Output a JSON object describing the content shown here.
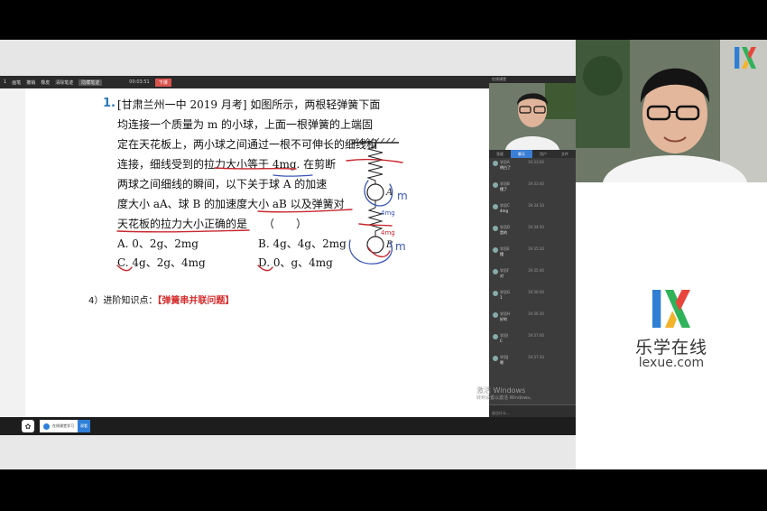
{
  "toolbar": {
    "items": [
      "1",
      "画笔",
      "撤销",
      "橡皮",
      "清除笔迹",
      "隐藏笔迹"
    ],
    "time": "00:03:51",
    "button": "下课"
  },
  "question": {
    "number": "1.",
    "lines": [
      "[甘肃兰州一中 2019 月考] 如图所示，两根轻弹簧下面",
      "均连接一个质量为 m 的小球，上面一根弹簧的上端固",
      "定在天花板上，两小球之间通过一根不可伸长的细线相",
      "连接，细线受到的拉力大小等于 4mg. 在剪断",
      "两球之间细线的瞬间，以下关于球 A 的加速",
      "度大小 aA、球 B 的加速度大小 aB 以及弹簧对",
      "天花板的拉力大小正确的是　　（　　）"
    ],
    "options": {
      "A": "A. 0、2g、2mg",
      "B": "B. 4g、4g、2mg",
      "C": "C. 4g、2g、4mg",
      "D": "D. 0、g、4mg"
    }
  },
  "advanced": {
    "prefix": "4）进阶知识点：",
    "highlight": "【弹簧串并联问题】"
  },
  "diagram": {
    "label_a": "A",
    "label_b": "B",
    "ink_m1": "m",
    "ink_m2": "m",
    "ink_4mg1": "4mg",
    "ink_4mg2": "4mg"
  },
  "panel": {
    "header": "在线课堂",
    "tabs": [
      "答疑",
      "聊天",
      "用户",
      "文件"
    ],
    "messages": [
      {
        "name": "学员A",
        "time": "19:33:00",
        "text": "明白了"
      },
      {
        "name": "学员B",
        "time": "19:33:40",
        "text": "懂了"
      },
      {
        "name": "学员C",
        "time": "19:34:10",
        "text": "4mg"
      },
      {
        "name": "学员D",
        "time": "19:34:50",
        "text": "是的"
      },
      {
        "name": "学员E",
        "time": "19:35:20",
        "text": "懂"
      },
      {
        "name": "学员F",
        "time": "19:35:40",
        "text": "对"
      },
      {
        "name": "学员G",
        "time": "19:36:00",
        "text": "1"
      },
      {
        "name": "学员H",
        "time": "19:36:30",
        "text": "好的"
      },
      {
        "name": "学员I",
        "time": "19:37:00",
        "text": "C"
      },
      {
        "name": "学员J",
        "time": "19:37:30",
        "text": "嗯"
      }
    ],
    "input_placeholder": "说点什么..."
  },
  "taskbar": {
    "task_label": "在线课堂学习",
    "task_button": "观看"
  },
  "watermark": {
    "line1": "激活 Windows",
    "line2": "转到设置以激活 Windows。"
  },
  "brand": {
    "name": "乐学在线",
    "url": "lexue.com",
    "colors": {
      "blue": "#2f80d4",
      "green": "#2fb25a",
      "red": "#e8453c",
      "yellow": "#f3b32a"
    }
  }
}
